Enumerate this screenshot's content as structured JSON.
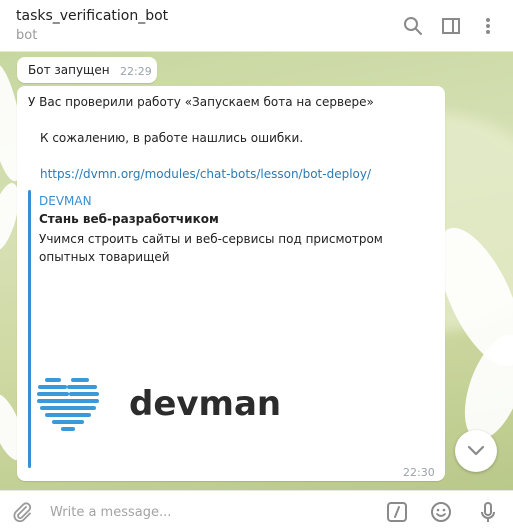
{
  "header": {
    "title": "tasks_verification_bot",
    "subtitle": "bot",
    "icons": [
      "search-icon",
      "sidebar-toggle-icon",
      "more-vert-icon"
    ]
  },
  "messages": [
    {
      "text": "Бот запущен",
      "time": "22:29"
    },
    {
      "line1": "У Вас проверили работу «Запускаем бота на сервере»",
      "line2": "К сожалению, в работе нашлись ошибки.",
      "link": "https://dvmn.org/modules/chat-bots/lesson/bot-deploy/",
      "preview": {
        "site": "DEVMAN",
        "title": "Стань веб-разработчиком",
        "description": "Учимся строить сайты и веб-сервисы под присмотром опытных товарищей",
        "logo_text": "devman"
      },
      "time": "22:30"
    }
  ],
  "composer": {
    "placeholder": "Write a message...",
    "icons": [
      "attach-icon",
      "commands-icon",
      "emoji-icon",
      "microphone-icon"
    ]
  },
  "colors": {
    "accent": "#3a8ed1",
    "link": "#2a7ab5"
  }
}
